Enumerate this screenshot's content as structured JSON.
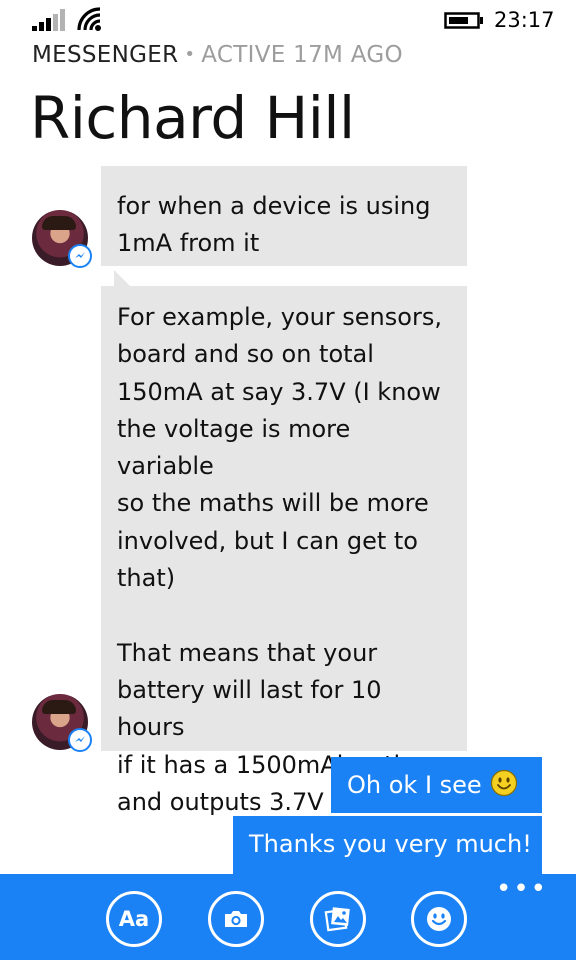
{
  "status_bar": {
    "time": "23:17"
  },
  "header": {
    "app_name": "MESSENGER",
    "separator": "•",
    "active_status": "ACTIVE 17M AGO",
    "contact_name": "Richard Hill"
  },
  "messages": {
    "incoming_1": "for when a device is using\n1mA from it",
    "incoming_2": "For example, your sensors,\nboard and so on total\n150mA at say 3.7V (I know\nthe voltage is more variable\nso the maths will be more\ninvolved, but I can get to\nthat)\n\nThat means that your\nbattery will last for 10 hours\nif it has a 1500mAh rating\nand outputs 3.7V",
    "outgoing_1": "Oh ok I see",
    "outgoing_2": "Thanks you very much!"
  },
  "app_bar": {
    "text_button_label": "Aa",
    "more_label": "•••"
  },
  "colors": {
    "accent": "#1b82f5",
    "bubble_in": "#e6e6e6",
    "smiley": "#f5d020"
  },
  "icons": [
    "signal-icon",
    "wifi-icon",
    "battery-icon",
    "messenger-badge-icon",
    "smiley-icon",
    "camera-icon",
    "photo-icon",
    "emoji-icon"
  ]
}
